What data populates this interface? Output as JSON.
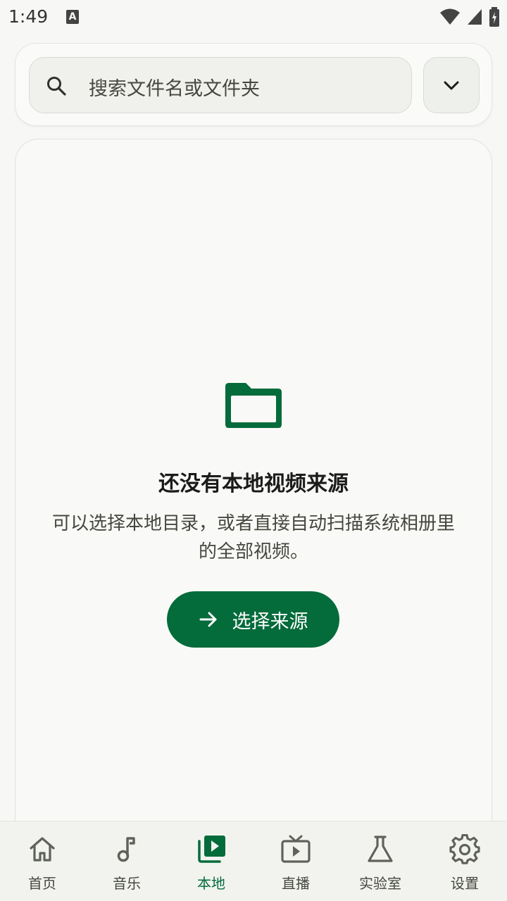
{
  "status": {
    "time": "1:49",
    "notification_badge": "A"
  },
  "search": {
    "placeholder": "搜索文件名或文件夹"
  },
  "empty_state": {
    "title": "还没有本地视频来源",
    "description": "可以选择本地目录，或者直接自动扫描系统相册里的全部视频。",
    "button_label": "选择来源",
    "icon": "folder-icon"
  },
  "nav": {
    "items": [
      {
        "label": "首页",
        "icon": "home-icon"
      },
      {
        "label": "音乐",
        "icon": "music-note-icon"
      },
      {
        "label": "本地",
        "icon": "video-library-icon",
        "active": true
      },
      {
        "label": "直播",
        "icon": "tv-icon"
      },
      {
        "label": "实验室",
        "icon": "flask-icon"
      },
      {
        "label": "设置",
        "icon": "gear-icon"
      }
    ]
  },
  "colors": {
    "accent": "#046b3b",
    "background": "#f7f8f5",
    "inactive": "#5f625b"
  }
}
